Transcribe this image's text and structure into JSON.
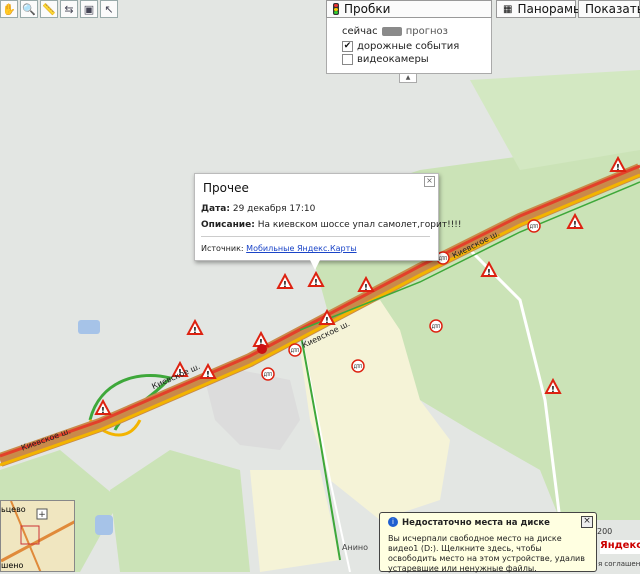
{
  "toolbar": {
    "buttons": [
      {
        "name": "hand-tool-icon",
        "glyph": "✋"
      },
      {
        "name": "zoom-tool-icon",
        "glyph": "🔍"
      },
      {
        "name": "ruler-icon",
        "glyph": "📏"
      },
      {
        "name": "route-icon",
        "glyph": "⇆"
      },
      {
        "name": "print-icon",
        "glyph": "▣"
      },
      {
        "name": "pointer-icon",
        "glyph": "↖"
      }
    ],
    "traffic_label": "Пробки",
    "panoramas_label": "Панорамы",
    "show_label": "Показать"
  },
  "traffic_panel": {
    "now_label": "сейчас",
    "forecast_label": "прогноз",
    "road_events_label": "дорожные события",
    "road_events_checked": true,
    "cameras_label": "видеокамеры",
    "cameras_checked": false
  },
  "popup": {
    "title": "Прочее",
    "date_label": "Дата:",
    "date_value": "29 декабря 17:10",
    "description_label": "Описание:",
    "description_value": "На киевском шоссе упал самолет,горит!!!!",
    "source_label": "Источник:",
    "source_link": "Мобильные Яндекс.Карты"
  },
  "map": {
    "road_name": "Киевское ш.",
    "place_anino": "Анино",
    "minimap_label": "ьцево",
    "minimap_bottom_label": "шено",
    "scale_label": "200",
    "brand": "Яндекс",
    "terms": "я соглашения",
    "incident_icon": "warning-triangle-icon",
    "accident_icon": "dtp-accident-icon",
    "accident_text": "ДТП",
    "colors": {
      "road_jam": "#e3402a",
      "road_slow": "#f3b400",
      "road_free": "#3ea83a",
      "forest": "#cbe3b7",
      "field": "#f5f3d7",
      "city": "#e3e6e3"
    }
  },
  "notification": {
    "title": "Недостаточно места на диске",
    "body": "Вы исчерпали свободное место на диске видео1 (D:). Щелкните здесь, чтобы освободить место на этом устройстве, удалив устаревшие или ненужные файлы."
  }
}
